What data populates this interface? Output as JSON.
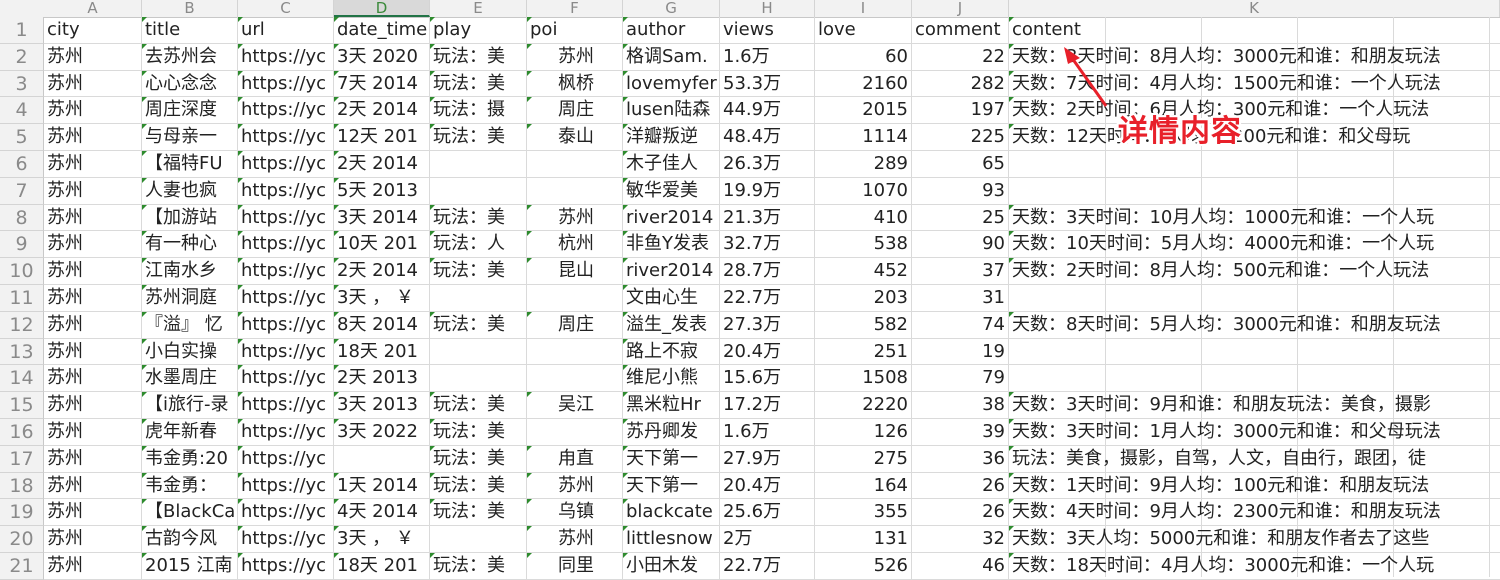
{
  "app": {
    "type": "spreadsheet"
  },
  "columns": [
    "A",
    "B",
    "C",
    "D",
    "E",
    "F",
    "G",
    "H",
    "I",
    "J",
    "K"
  ],
  "selected_column": "D",
  "headers": [
    "city",
    "title",
    "url",
    "date_time",
    "play",
    "poi",
    "author",
    "views",
    "love",
    "comment",
    "content"
  ],
  "rows": [
    {
      "n": "2",
      "city": "苏州",
      "title": "去苏州会",
      "url": "https://yc",
      "date_time": "3天 2020",
      "play": "玩法：美",
      "poi": "苏州",
      "author": "格调Sam.",
      "views": "1.6万",
      "love": "60",
      "comment": "22",
      "content": "天数：3天时间：8月人均：3000元和谁：和朋友玩法"
    },
    {
      "n": "3",
      "city": "苏州",
      "title": "心心念念",
      "url": "https://yc",
      "date_time": "7天 2014",
      "play": "玩法：美",
      "poi": "枫桥",
      "author": "lovemyfer",
      "views": "53.3万",
      "love": "2160",
      "comment": "282",
      "content": "天数：7天时间：4月人均：1500元和谁：一个人玩法"
    },
    {
      "n": "4",
      "city": "苏州",
      "title": "周庄深度",
      "url": "https://yc",
      "date_time": "2天 2014",
      "play": "玩法：摄",
      "poi": "周庄",
      "author": "lusen陆森",
      "views": "44.9万",
      "love": "2015",
      "comment": "197",
      "content": "天数：2天时间：6月人均：300元和谁：一个人玩法"
    },
    {
      "n": "5",
      "city": "苏州",
      "title": "与母亲一",
      "url": "https://yc",
      "date_time": "12天 201",
      "play": "玩法：美",
      "poi": "泰山",
      "author": "洋瓣叛逆",
      "views": "48.4万",
      "love": "1114",
      "comment": "225",
      "content": "天数：12天时间：  人均：9200元和谁：和父母玩"
    },
    {
      "n": "6",
      "city": "苏州",
      "title": "【福特FU",
      "url": "https://yc",
      "date_time": "2天 2014",
      "play": "",
      "poi": "",
      "author": "木子佳人",
      "views": "26.3万",
      "love": "289",
      "comment": "65",
      "content": ""
    },
    {
      "n": "7",
      "city": "苏州",
      "title": "人妻也疯",
      "url": "https://yc",
      "date_time": "5天 2013",
      "play": "",
      "poi": "",
      "author": "敏华爱美",
      "views": "19.9万",
      "love": "1070",
      "comment": "93",
      "content": ""
    },
    {
      "n": "8",
      "city": "苏州",
      "title": "【加游站",
      "url": "https://yc",
      "date_time": "3天 2014",
      "play": "玩法：美",
      "poi": "苏州",
      "author": "river2014",
      "views": "21.3万",
      "love": "410",
      "comment": "25",
      "content": "天数：3天时间：10月人均：1000元和谁：一个人玩"
    },
    {
      "n": "9",
      "city": "苏州",
      "title": "有一种心",
      "url": "https://yc",
      "date_time": "10天 201",
      "play": "玩法：人",
      "poi": "杭州",
      "author": "非鱼Y发表",
      "views": "32.7万",
      "love": "538",
      "comment": "90",
      "content": "天数：10天时间：5月人均：4000元和谁：一个人玩"
    },
    {
      "n": "10",
      "city": "苏州",
      "title": "江南水乡",
      "url": "https://yc",
      "date_time": "2天 2014",
      "play": "玩法：美",
      "poi": "昆山",
      "author": "river2014",
      "views": "28.7万",
      "love": "452",
      "comment": "37",
      "content": "天数：2天时间：8月人均：500元和谁：一个人玩法"
    },
    {
      "n": "11",
      "city": "苏州",
      "title": "苏州洞庭",
      "url": "https://yc",
      "date_time": "3天 ， ￥",
      "play": "",
      "poi": "",
      "author": "文由心生",
      "views": "22.7万",
      "love": "203",
      "comment": "31",
      "content": ""
    },
    {
      "n": "12",
      "city": "苏州",
      "title": "『溢』 忆",
      "url": "https://yc",
      "date_time": "8天 2014",
      "play": "玩法：美",
      "poi": "周庄",
      "author": "溢生_发表",
      "views": "27.3万",
      "love": "582",
      "comment": "74",
      "content": "天数：8天时间：5月人均：3000元和谁：和朋友玩法"
    },
    {
      "n": "13",
      "city": "苏州",
      "title": "小白实操",
      "url": "https://yc",
      "date_time": "18天 201",
      "play": "",
      "poi": "",
      "author": "路上不寂",
      "views": "20.4万",
      "love": "251",
      "comment": "19",
      "content": ""
    },
    {
      "n": "14",
      "city": "苏州",
      "title": "水墨周庄",
      "url": "https://yc",
      "date_time": "2天 2013",
      "play": "",
      "poi": "",
      "author": "维尼小熊",
      "views": "15.6万",
      "love": "1508",
      "comment": "79",
      "content": ""
    },
    {
      "n": "15",
      "city": "苏州",
      "title": "【i旅行-录",
      "url": "https://yc",
      "date_time": "3天 2013",
      "play": "玩法：美",
      "poi": "吴江",
      "author": "黑米粒Hr",
      "views": "17.2万",
      "love": "2220",
      "comment": "38",
      "content": "天数：3天时间：9月和谁：和朋友玩法：美食，摄影"
    },
    {
      "n": "16",
      "city": "苏州",
      "title": "虎年新春",
      "url": "https://yc",
      "date_time": "3天 2022",
      "play": "玩法：美",
      "poi": "",
      "author": "苏丹卿发",
      "views": "1.6万",
      "love": "126",
      "comment": "39",
      "content": "天数：3天时间：1月人均：3000元和谁：和父母玩法"
    },
    {
      "n": "17",
      "city": "苏州",
      "title": "韦金勇:20",
      "url": "https://yc",
      "date_time": "",
      "play": "玩法：美",
      "poi": "甪直",
      "author": "天下第一",
      "views": "27.9万",
      "love": "275",
      "comment": "36",
      "content": "玩法：美食，摄影，自驾，人文，自由行，跟团，徒"
    },
    {
      "n": "18",
      "city": "苏州",
      "title": "韦金勇：",
      "url": "https://yc",
      "date_time": "1天 2014",
      "play": "玩法：美",
      "poi": "苏州",
      "author": "天下第一",
      "views": "20.4万",
      "love": "164",
      "comment": "26",
      "content": "天数：1天时间：9月人均：100元和谁：和朋友玩法"
    },
    {
      "n": "19",
      "city": "苏州",
      "title": "【BlackCa",
      "url": "https://yc",
      "date_time": "4天 2014",
      "play": "玩法：美",
      "poi": "乌镇",
      "author": "blackcate",
      "views": "25.6万",
      "love": "355",
      "comment": "26",
      "content": "天数：4天时间：9月人均：2300元和谁：和朋友玩法"
    },
    {
      "n": "20",
      "city": "苏州",
      "title": "古韵今风",
      "url": "https://yc",
      "date_time": "3天 ， ￥",
      "play": "",
      "poi": "苏州",
      "author": "littlesnow",
      "views": "2万",
      "love": "131",
      "comment": "32",
      "content": "天数：3天人均：5000元和谁：和朋友作者去了这些"
    },
    {
      "n": "21",
      "city": "苏州",
      "title": "2015 江南",
      "url": "https://yc",
      "date_time": "18天 201",
      "play": "玩法：美",
      "poi": "同里",
      "author": "小田木发",
      "views": "22.7万",
      "love": "526",
      "comment": "46",
      "content": "天数：18天时间：4月人均：3000元和谁：一个人玩"
    }
  ],
  "annotation": {
    "label": "详情内容",
    "color": "#e8202a",
    "icon": "arrow-icon"
  },
  "colors": {
    "header_bg": "#f2f2f2",
    "selected_col_accent": "#217346",
    "comment_marker": "#2e8b2e"
  }
}
